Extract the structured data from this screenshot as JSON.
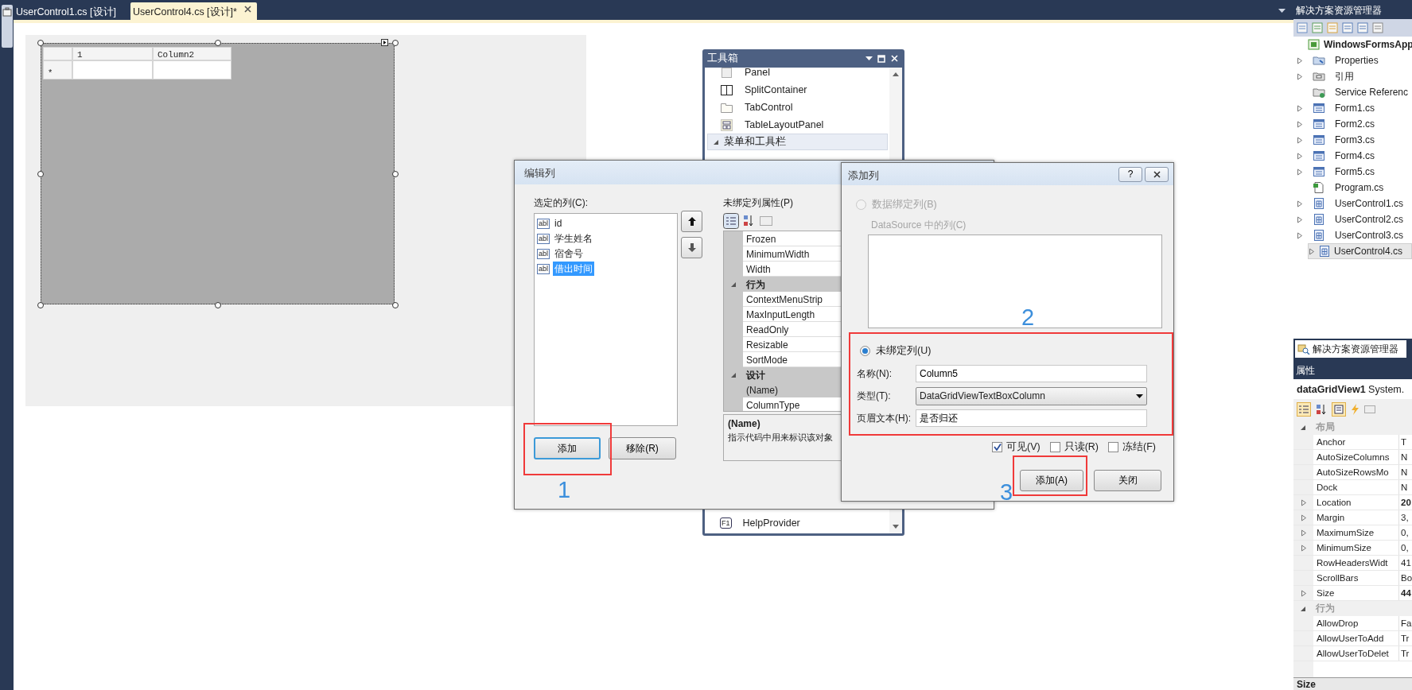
{
  "document_tabs": [
    {
      "label": "UserControl1.cs [设计]",
      "selected": false
    },
    {
      "label": "UserControl4.cs [设计]*",
      "selected": true
    }
  ],
  "designer": {
    "grid_columns": [
      "1",
      "Column2"
    ],
    "new_row_marker": "*"
  },
  "toolbox": {
    "title": "工具箱",
    "items": [
      {
        "kind": "panel",
        "label": "Panel"
      },
      {
        "kind": "split",
        "label": "SplitContainer"
      },
      {
        "kind": "tab",
        "label": "TabControl"
      },
      {
        "kind": "table",
        "label": "TableLayoutPanel"
      },
      {
        "kind": "group",
        "label": "菜单和工具栏",
        "expanded": true
      }
    ],
    "bottom_items": [
      {
        "kind": "help",
        "icon_text": "F1",
        "label": "HelpProvider"
      }
    ]
  },
  "edit_columns_dialog": {
    "title": "编辑列",
    "columns_label": "选定的列(C):",
    "columns": [
      {
        "type_tag": "abl",
        "label": "id",
        "selected": false
      },
      {
        "type_tag": "abl",
        "label": "学生姓名",
        "selected": false
      },
      {
        "type_tag": "abl",
        "label": "宿舍号",
        "selected": false
      },
      {
        "type_tag": "abl",
        "label": "借出时间",
        "selected": true
      }
    ],
    "properties_label": "未绑定列属性(P)",
    "property_rows": [
      {
        "kind": "property",
        "name": "Frozen",
        "selected": false
      },
      {
        "kind": "property",
        "name": "MinimumWidth",
        "selected": false
      },
      {
        "kind": "property",
        "name": "Width",
        "selected": false
      },
      {
        "kind": "category",
        "name": "行为",
        "expanded": true
      },
      {
        "kind": "property",
        "name": "ContextMenuStrip",
        "selected": false
      },
      {
        "kind": "property",
        "name": "MaxInputLength",
        "selected": false
      },
      {
        "kind": "property",
        "name": "ReadOnly",
        "selected": false
      },
      {
        "kind": "property",
        "name": "Resizable",
        "selected": false
      },
      {
        "kind": "property",
        "name": "SortMode",
        "selected": false
      },
      {
        "kind": "category",
        "name": "设计",
        "expanded": true
      },
      {
        "kind": "property",
        "name": "(Name)",
        "selected": true
      },
      {
        "kind": "property",
        "name": "ColumnType",
        "selected": false
      }
    ],
    "description": {
      "title": "(Name)",
      "text": "指示代码中用来标识该对象"
    },
    "buttons": [
      {
        "label": "添加",
        "focused": true
      },
      {
        "label": "移除(R)",
        "focused": false
      }
    ],
    "annotation": "1"
  },
  "add_column_dialog": {
    "title": "添加列",
    "help_button": "?",
    "bound_option": {
      "label": "数据绑定列(B)",
      "selected": false,
      "disabled": true
    },
    "source_label": "DataSource 中的列(C)",
    "annotation_list": "2",
    "unbound_option": {
      "label": "未绑定列(U)",
      "selected": true,
      "disabled": false
    },
    "fields": [
      {
        "kind": "text",
        "label": "名称(N):",
        "value": "Column5"
      },
      {
        "kind": "select",
        "label": "类型(T):",
        "value": "DataGridViewTextBoxColumn"
      },
      {
        "kind": "text",
        "label": "页眉文本(H):",
        "value": "是否归还"
      }
    ],
    "checkboxes": [
      {
        "label": "可见(V)",
        "checked": true
      },
      {
        "label": "只读(R)",
        "checked": false
      },
      {
        "label": "冻结(F)",
        "checked": false
      }
    ],
    "buttons": [
      {
        "label": "添加(A)"
      },
      {
        "label": "关闭"
      }
    ],
    "annotation": "3"
  },
  "solution_explorer": {
    "title": "解决方案资源管理器",
    "tree": [
      {
        "kind": "project",
        "label": "WindowsFormsApp",
        "children": [
          {
            "kind": "properties",
            "label": "Properties",
            "expandable": true,
            "selected": false
          },
          {
            "kind": "references",
            "label": "引用",
            "expandable": true,
            "selected": false
          },
          {
            "kind": "service",
            "label": "Service Referenc",
            "expandable": false,
            "selected": false
          },
          {
            "kind": "form",
            "label": "Form1.cs",
            "expandable": true,
            "selected": false
          },
          {
            "kind": "form",
            "label": "Form2.cs",
            "expandable": true,
            "selected": false
          },
          {
            "kind": "form",
            "label": "Form3.cs",
            "expandable": true,
            "selected": false
          },
          {
            "kind": "form",
            "label": "Form4.cs",
            "expandable": true,
            "selected": false
          },
          {
            "kind": "form",
            "label": "Form5.cs",
            "expandable": true,
            "selected": false
          },
          {
            "kind": "code",
            "label": "Program.cs",
            "expandable": false,
            "selected": false
          },
          {
            "kind": "usercontrol",
            "label": "UserControl1.cs",
            "expandable": true,
            "selected": false
          },
          {
            "kind": "usercontrol",
            "label": "UserControl2.cs",
            "expandable": true,
            "selected": false
          },
          {
            "kind": "usercontrol",
            "label": "UserControl3.cs",
            "expandable": true,
            "selected": false
          },
          {
            "kind": "usercontrol",
            "label": "UserControl4.cs",
            "expandable": true,
            "selected": true
          }
        ]
      }
    ],
    "bottom_tab": "解决方案资源管理器"
  },
  "properties_panel": {
    "title": "属性",
    "object_name": "dataGridView1",
    "object_type": "System.",
    "rows": [
      {
        "kind": "category",
        "name": "布局",
        "expanded": true
      },
      {
        "kind": "property",
        "name": "Anchor",
        "value": "T",
        "expandable": false,
        "bold": false
      },
      {
        "kind": "property",
        "name": "AutoSizeColumns",
        "value": "N",
        "expandable": false,
        "bold": false
      },
      {
        "kind": "property",
        "name": "AutoSizeRowsMo",
        "value": "N",
        "expandable": false,
        "bold": false
      },
      {
        "kind": "property",
        "name": "Dock",
        "value": "N",
        "expandable": false,
        "bold": false
      },
      {
        "kind": "property",
        "name": "Location",
        "value": "20",
        "expandable": true,
        "bold": true
      },
      {
        "kind": "property",
        "name": "Margin",
        "value": "3,",
        "expandable": true,
        "bold": false
      },
      {
        "kind": "property",
        "name": "MaximumSize",
        "value": "0,",
        "expandable": true,
        "bold": false
      },
      {
        "kind": "property",
        "name": "MinimumSize",
        "value": "0,",
        "expandable": true,
        "bold": false
      },
      {
        "kind": "property",
        "name": "RowHeadersWidt",
        "value": "41",
        "expandable": false,
        "bold": false
      },
      {
        "kind": "property",
        "name": "ScrollBars",
        "value": "Bo",
        "expandable": false,
        "bold": false
      },
      {
        "kind": "property",
        "name": "Size",
        "value": "44",
        "expandable": true,
        "bold": true
      },
      {
        "kind": "category",
        "name": "行为",
        "expanded": true
      },
      {
        "kind": "property",
        "name": "AllowDrop",
        "value": "Fa",
        "expandable": false,
        "bold": false
      },
      {
        "kind": "property",
        "name": "AllowUserToAdd",
        "value": "Tr",
        "expandable": false,
        "bold": false
      },
      {
        "kind": "property",
        "name": "AllowUserToDelet",
        "value": "Tr",
        "expandable": false,
        "bold": false
      }
    ],
    "description_title": "Size"
  }
}
